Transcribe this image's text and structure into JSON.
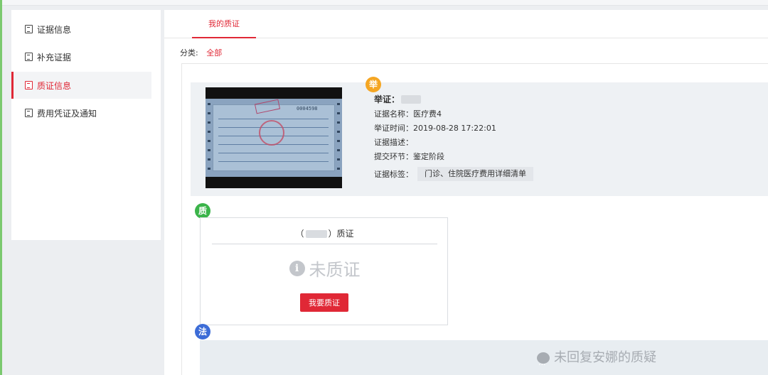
{
  "sidebar": {
    "items": [
      {
        "label": "证据信息",
        "active": false
      },
      {
        "label": "补充证据",
        "active": false
      },
      {
        "label": "质证信息",
        "active": true
      },
      {
        "label": "费用凭证及通知",
        "active": false
      }
    ]
  },
  "tabs": {
    "active_label": "我的质证"
  },
  "filter": {
    "label": "分类:",
    "value": "全部"
  },
  "evidence": {
    "badge": "举",
    "title_prefix": "举证：",
    "name": "证据名称：医疗费4",
    "time": "举证时间：2019-08-28 17:22:01",
    "desc": "证据描述：",
    "stage": "提交环节：鉴定阶段",
    "tag_label": "证据标签：",
    "tag_value": "门诊、住院医疗费用详细清单",
    "receipt_number": "0004598"
  },
  "cross_exam": {
    "badge": "质",
    "head_prefix": "（",
    "head_suffix": "）质证",
    "status_icon": "i",
    "status": "未质证",
    "button_label": "我要质证"
  },
  "court": {
    "badge": "法",
    "message": "未回复安娜的质疑"
  },
  "colors": {
    "accent": "#e02836",
    "badge_orange": "#f5a623",
    "badge_green": "#3bb44a",
    "badge_blue": "#3c6cd7"
  }
}
